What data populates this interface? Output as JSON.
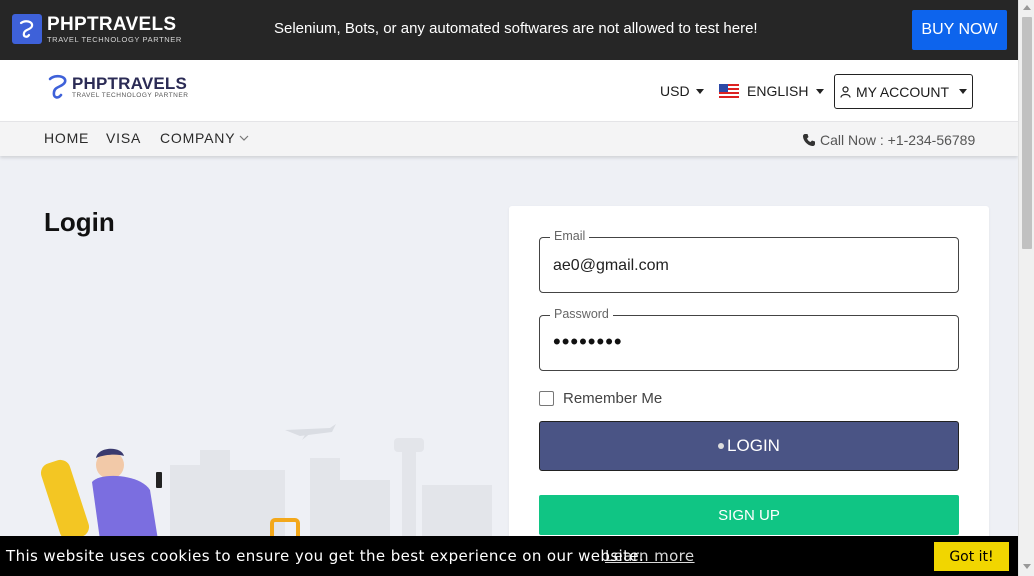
{
  "topbar": {
    "logo_name": "PHPTRAVELS",
    "logo_tagline": "TRAVEL TECHNOLOGY PARTNER",
    "notice": "Selenium, Bots, or any automated softwares are not allowed to test here!",
    "buy_now": "BUY NOW"
  },
  "header": {
    "logo_name": "PHPTRAVELS",
    "logo_tagline": "TRAVEL TECHNOLOGY PARTNER",
    "currency": "USD",
    "language": "ENGLISH",
    "account": "MY ACCOUNT"
  },
  "nav": {
    "items": [
      "HOME",
      "VISA",
      "COMPANY"
    ],
    "call": "Call Now : +1-234-56789"
  },
  "main": {
    "title": "Login"
  },
  "form": {
    "email_label": "Email",
    "email_value": "ae0@gmail.com",
    "password_label": "Password",
    "password_value": "••••••••",
    "remember": "Remember Me",
    "login_button": "LOGIN",
    "signup_button": "SIGN UP"
  },
  "cookie": {
    "message": "This website uses cookies to ensure you get the best experience on our website.",
    "link": "Learn more",
    "button": "Got it!"
  },
  "colors": {
    "topbar_bg": "#262626",
    "buy_now": "#0d64ed",
    "login_button": "#4a5485",
    "signup_button": "#10c584",
    "cookie_button": "#f1d600"
  }
}
